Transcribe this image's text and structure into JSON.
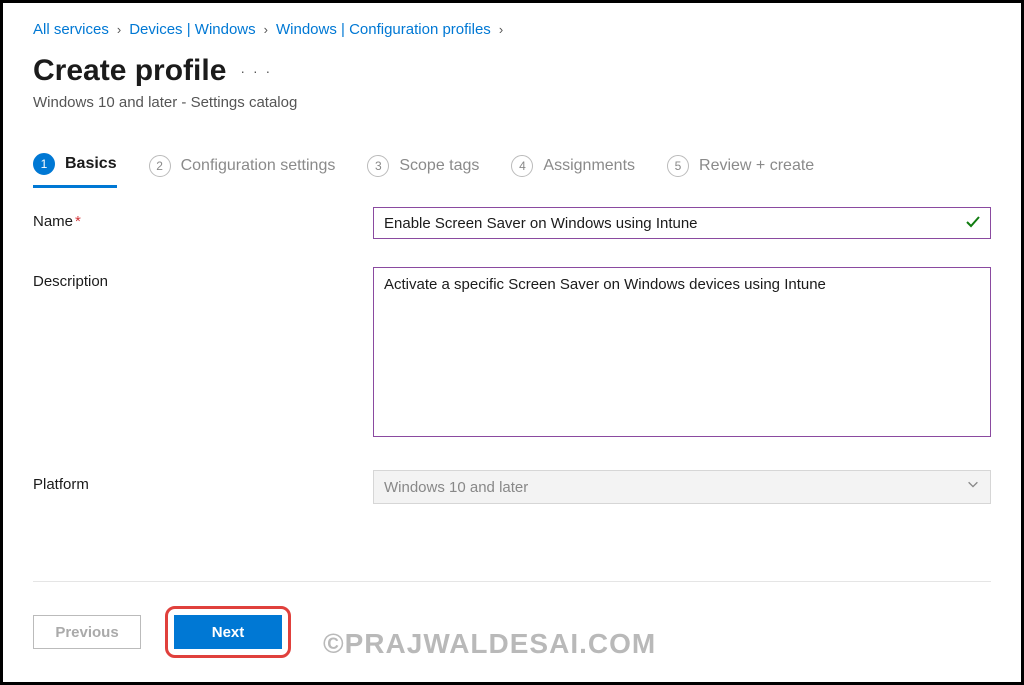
{
  "breadcrumb": {
    "items": [
      "All services",
      "Devices | Windows",
      "Windows | Configuration profiles"
    ]
  },
  "header": {
    "title": "Create profile",
    "subtitle": "Windows 10 and later - Settings catalog"
  },
  "stepper": {
    "steps": [
      {
        "num": "1",
        "label": "Basics"
      },
      {
        "num": "2",
        "label": "Configuration settings"
      },
      {
        "num": "3",
        "label": "Scope tags"
      },
      {
        "num": "4",
        "label": "Assignments"
      },
      {
        "num": "5",
        "label": "Review + create"
      }
    ]
  },
  "form": {
    "name_label": "Name",
    "name_value": "Enable Screen Saver on Windows using Intune",
    "description_label": "Description",
    "description_value": "Activate a specific Screen Saver on Windows devices using Intune",
    "platform_label": "Platform",
    "platform_value": "Windows 10 and later"
  },
  "footer": {
    "previous": "Previous",
    "next": "Next"
  },
  "watermark": "©PRAJWALDESAI.COM"
}
